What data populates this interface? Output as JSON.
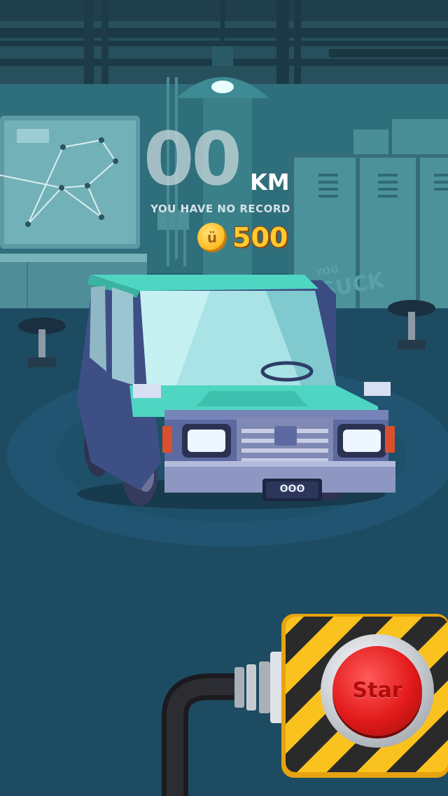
{
  "hud": {
    "distance_value": "00",
    "distance_unit": "KM",
    "record_text": "YOU HAVE NO RECORD",
    "coin_count": "500"
  },
  "car": {
    "plate_text": "ʘʘʘ"
  },
  "graffiti": {
    "text": "YOU SUCK"
  },
  "controls": {
    "start_label": "Star"
  },
  "colors": {
    "background": "#1e4a5e",
    "car_body": "#3e4f86",
    "car_roof": "#4fd6c2",
    "coin": "#ffcb2f",
    "hazard_yellow": "#f9c21e",
    "start_red": "#e21a1a"
  }
}
